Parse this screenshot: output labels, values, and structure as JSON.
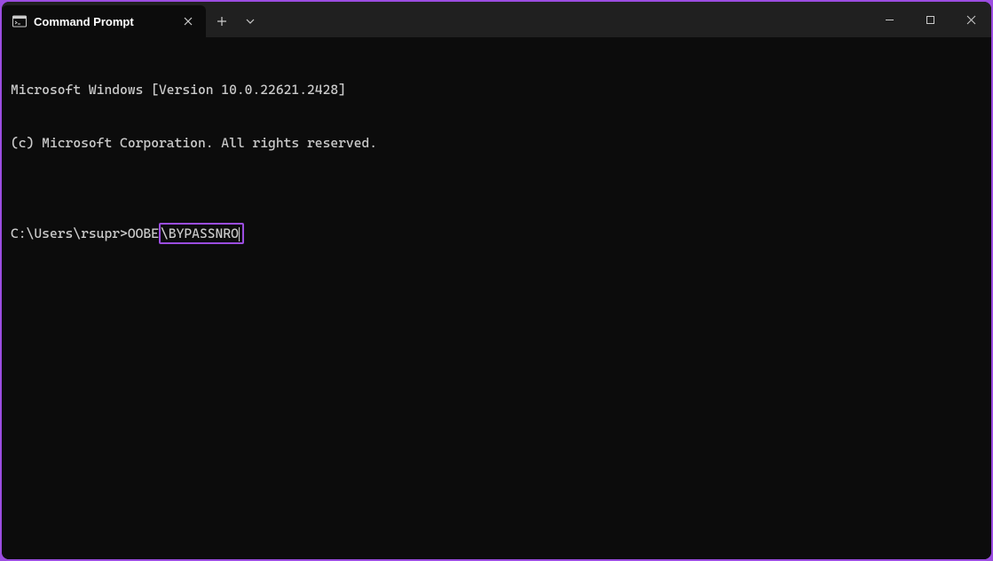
{
  "tab": {
    "title": "Command Prompt"
  },
  "terminal": {
    "line1": "Microsoft Windows [Version 10.0.22621.2428]",
    "line2": "(c) Microsoft Corporation. All rights reserved.",
    "blank": "",
    "prompt_prefix": "C:\\Users\\rsupr>OOBE",
    "prompt_highlight": "\\BYPASSNRO"
  },
  "colors": {
    "accent": "#9b4de0",
    "terminal_bg": "#0c0c0c",
    "titlebar_bg": "#202020",
    "text": "#cccccc"
  }
}
